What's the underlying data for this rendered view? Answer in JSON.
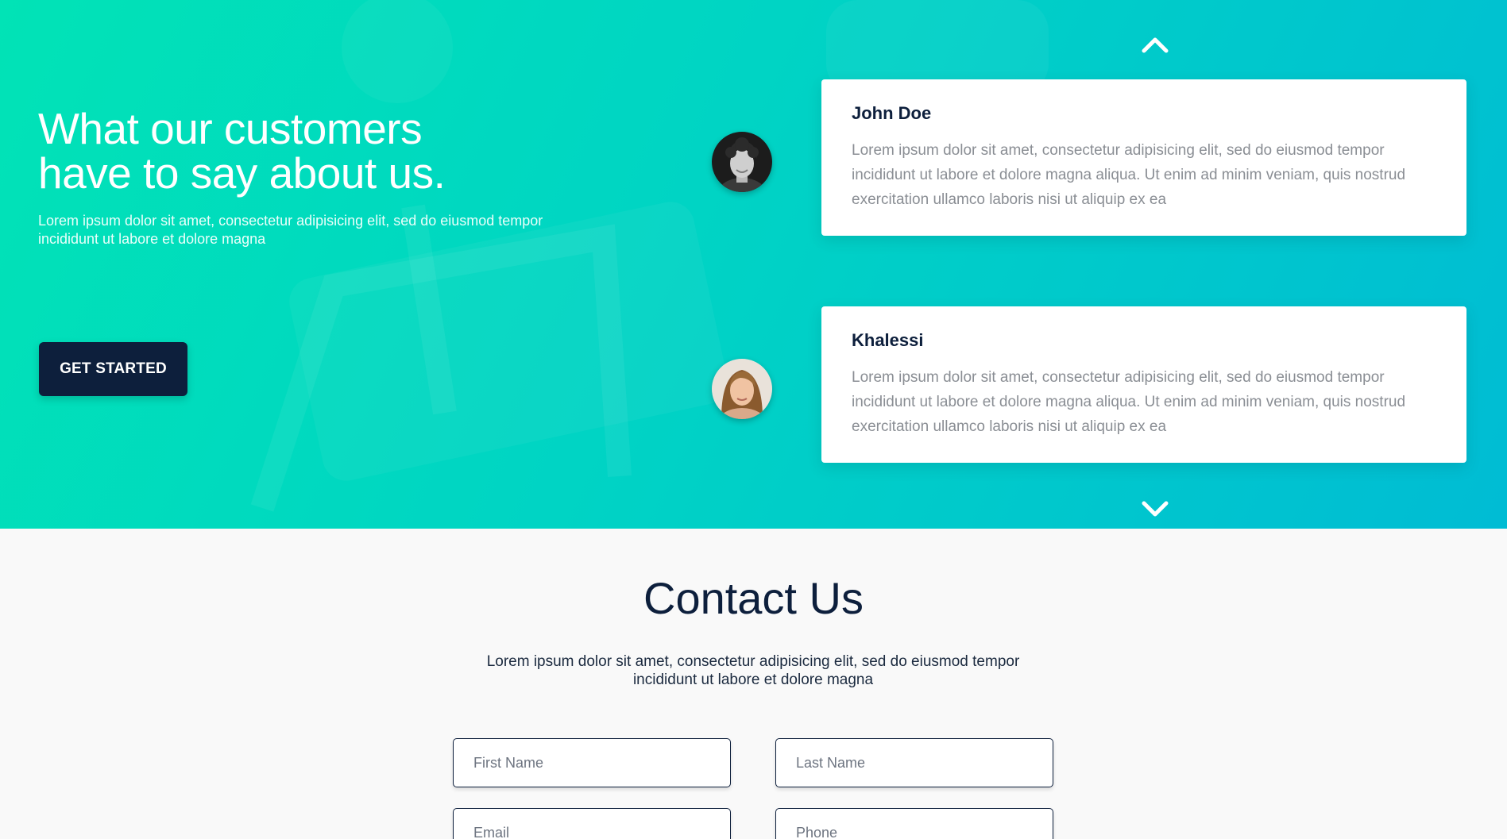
{
  "testimonials_section": {
    "title_line1": "What our customers",
    "title_line2": "have to say about us.",
    "subtitle": "Lorem ipsum dolor sit amet, consectetur adipisicing elit, sed do eiusmod tempor incididunt ut labore et dolore magna",
    "cta_label": "GET STARTED",
    "testimonials": [
      {
        "name": "John Doe",
        "text": "Lorem ipsum dolor sit amet, consectetur adipisicing elit, sed do eiusmod tempor incididunt ut labore et dolore magna aliqua. Ut enim ad minim veniam, quis nostrud exercitation ullamco laboris nisi ut aliquip ex ea",
        "avatar_icon": "avatar-man-curly-hair"
      },
      {
        "name": "Khalessi",
        "text": "Lorem ipsum dolor sit amet, consectetur adipisicing elit, sed do eiusmod tempor incididunt ut labore et dolore magna aliqua. Ut enim ad minim veniam, quis nostrud exercitation ullamco laboris nisi ut aliquip ex ea",
        "avatar_icon": "avatar-woman"
      }
    ],
    "nav_icons": [
      "chevron-up-icon",
      "chevron-down-icon"
    ]
  },
  "contact_section": {
    "title": "Contact Us",
    "subtitle": "Lorem ipsum dolor sit amet, consectetur adipisicing elit, sed do eiusmod tempor incididunt ut labore et dolore magna",
    "fields": {
      "first_name_placeholder": "First Name",
      "last_name_placeholder": "Last Name",
      "email_placeholder": "Email",
      "phone_placeholder": "Phone"
    }
  },
  "colors": {
    "gradient_start": "#01e3b6",
    "gradient_end": "#00bcd4",
    "navy": "#0d1f3c",
    "card_text": "#8a8e94",
    "page_bg": "#f9f9f9"
  }
}
